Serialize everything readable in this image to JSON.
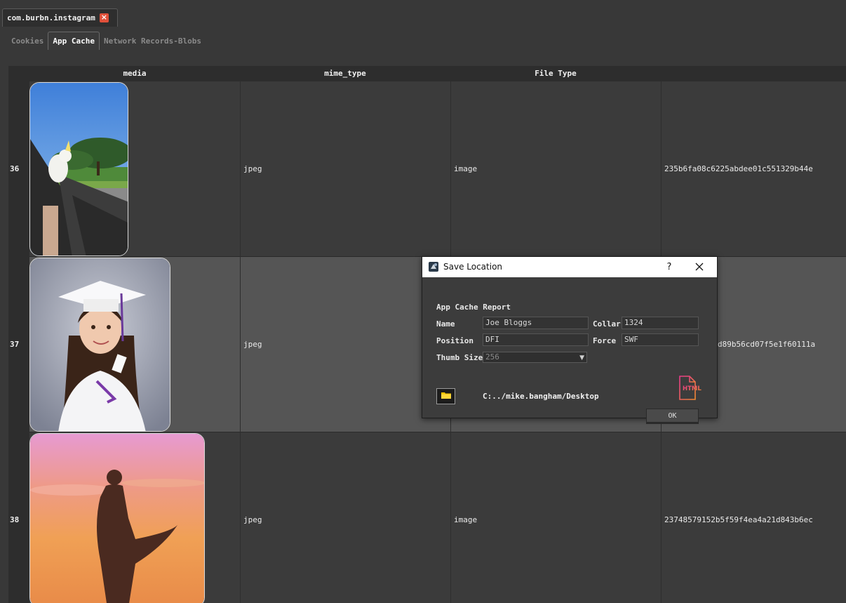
{
  "document_tab": {
    "title": "com.burbn.instagram",
    "close_label": "×"
  },
  "sub_tabs": [
    {
      "label": "Cookies",
      "active": false
    },
    {
      "label": "App Cache",
      "active": true
    },
    {
      "label": "Network Records-Blobs",
      "active": false
    }
  ],
  "table": {
    "columns": [
      "media",
      "mime_type",
      "File Type",
      ""
    ],
    "rows": [
      {
        "num": "36",
        "media_desc": "cockatoo-car-photo",
        "mime_type": "jpeg",
        "file_type": "image",
        "hash": "235b6fa08c6225abdee01c551329b44e",
        "selected": false
      },
      {
        "num": "37",
        "media_desc": "graduation-girl-photo",
        "mime_type": "jpeg",
        "file_type": "",
        "hash": "d89b56cd07f5e1f60111a",
        "selected": true
      },
      {
        "num": "38",
        "media_desc": "silhouette-sunset-photo",
        "mime_type": "jpeg",
        "file_type": "image",
        "hash": "23748579152b5f59f4ea4a21d843b6ec",
        "selected": false
      }
    ]
  },
  "dialog": {
    "title": "Save Location",
    "help_label": "?",
    "heading": "App Cache Report",
    "fields": {
      "name_label": "Name",
      "name_value": "Joe Bloggs",
      "collar_label": "Collar",
      "collar_value": "1324",
      "position_label": "Position",
      "position_value": "DFI",
      "force_label": "Force",
      "force_value": "SWF",
      "thumb_label": "Thumb Size",
      "thumb_value": "256"
    },
    "path": "C:../mike.bangham/Desktop",
    "html_icon_text": "HTML",
    "ok_label": "OK"
  },
  "colors": {
    "background": "#383838",
    "selected_row": "#555555",
    "header": "#2d2d2d",
    "close_tab": "#e0503a",
    "html_icon": "#e8487a"
  }
}
